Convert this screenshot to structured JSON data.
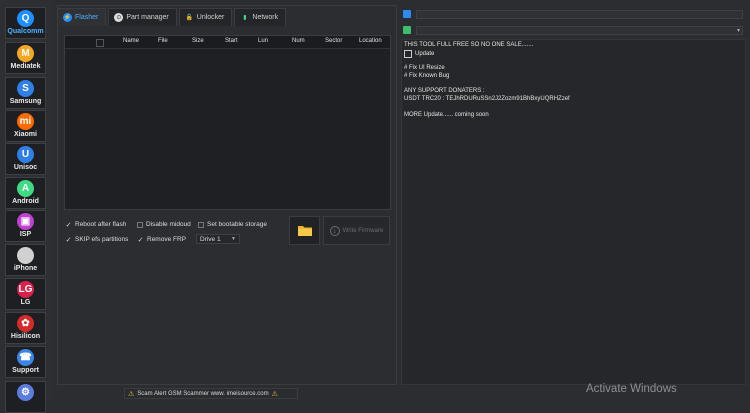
{
  "sidebar": {
    "items": [
      {
        "label": "Qualcomm",
        "glyph": "Q",
        "color": "#1e8fff",
        "active": true
      },
      {
        "label": "Mediatek",
        "glyph": "M",
        "color": "#f5a623"
      },
      {
        "label": "Samsung",
        "glyph": "S",
        "color": "#2f7fe6"
      },
      {
        "label": "Xiaomi",
        "glyph": "mi",
        "color": "#ff6a00"
      },
      {
        "label": "Unisoc",
        "glyph": "U",
        "color": "#2f7fe6"
      },
      {
        "label": "Android",
        "glyph": "A",
        "color": "#3ddc84"
      },
      {
        "label": "ISP",
        "glyph": "▣",
        "color": "#c040d0"
      },
      {
        "label": "iPhone",
        "glyph": "",
        "color": "#d0d0d0"
      },
      {
        "label": "LG",
        "glyph": "LG",
        "color": "#d8204a"
      },
      {
        "label": "Hisilicon",
        "glyph": "✿",
        "color": "#d52b2b"
      },
      {
        "label": "Support",
        "glyph": "☎",
        "color": "#3a86e8"
      },
      {
        "label": "",
        "glyph": "⚙",
        "color": "#5c7de0"
      }
    ]
  },
  "tabs": [
    {
      "label": "Flasher",
      "active": true,
      "icon": "flash-icon"
    },
    {
      "label": "Part manager",
      "icon": "partition-icon"
    },
    {
      "label": "Unlocker",
      "icon": "lock-icon"
    },
    {
      "label": "Network",
      "icon": "network-icon"
    }
  ],
  "table": {
    "columns": [
      "Name",
      "File",
      "Size",
      "Start",
      "Lun",
      "Num",
      "Sector",
      "Location"
    ]
  },
  "options": {
    "reboot": "Reboot after flash",
    "disable_midoud": "Disable midoud",
    "set_bootable": "Set bootable storage",
    "skip_efs": "SKIP efs partitions",
    "remove_frp": "Remove FRP",
    "drive": "Drive 1"
  },
  "buttons": {
    "write_firmware": "Write Firmware"
  },
  "footer": {
    "scam_alert": "Scam Alert GSM Scammer www. imeisource.com"
  },
  "log": {
    "lines": [
      "THIS TOOL FULL FREE SO NO ONE SALE.......",
      "Update",
      "# Fix UI Resize",
      "# Fix Known Bug",
      "ANY SUPPORT DONATERS :",
      "USDT TRC20 : TEJhRDURuSSn2J2Zozm91BhBxyUQRHZzef",
      "MORE Update......  coming soon"
    ]
  },
  "watermark": "Activate Windows"
}
